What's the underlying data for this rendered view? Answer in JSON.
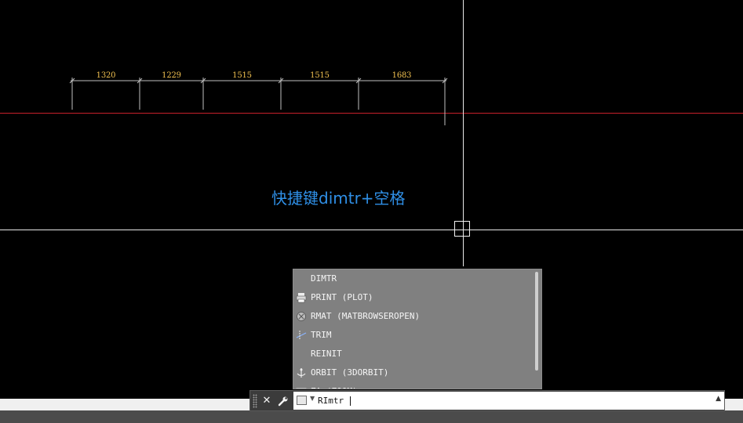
{
  "dimensions": {
    "values": [
      "1320",
      "1229",
      "1515",
      "1515",
      "1683"
    ],
    "color": "#f0c050",
    "line_color": "#bfbfbf"
  },
  "caption": "快捷键dimtr+空格",
  "colors": {
    "background": "#000000",
    "crosshair": "#e8e8e8",
    "red_line": "#c8202b",
    "caption": "#2f8fe6",
    "autocomplete_bg": "#808080"
  },
  "autocomplete": {
    "items": [
      {
        "label": "DIMTR",
        "icon": "none"
      },
      {
        "label": "PRINT (PLOT)",
        "icon": "printer-icon"
      },
      {
        "label": "RMAT (MATBROWSEROPEN)",
        "icon": "material-icon"
      },
      {
        "label": "TRIM",
        "icon": "trim-icon"
      },
      {
        "label": "REINIT",
        "icon": "none"
      },
      {
        "label": "ORBIT (3DORBIT)",
        "icon": "orbit-icon"
      },
      {
        "label": "ZA (ZOOM)",
        "icon": "zoom-icon"
      }
    ]
  },
  "command_line": {
    "close_label": "✕",
    "settings_icon": "wrench-icon",
    "prompt_icon": "command-prompt-icon",
    "value": "RImtr"
  }
}
